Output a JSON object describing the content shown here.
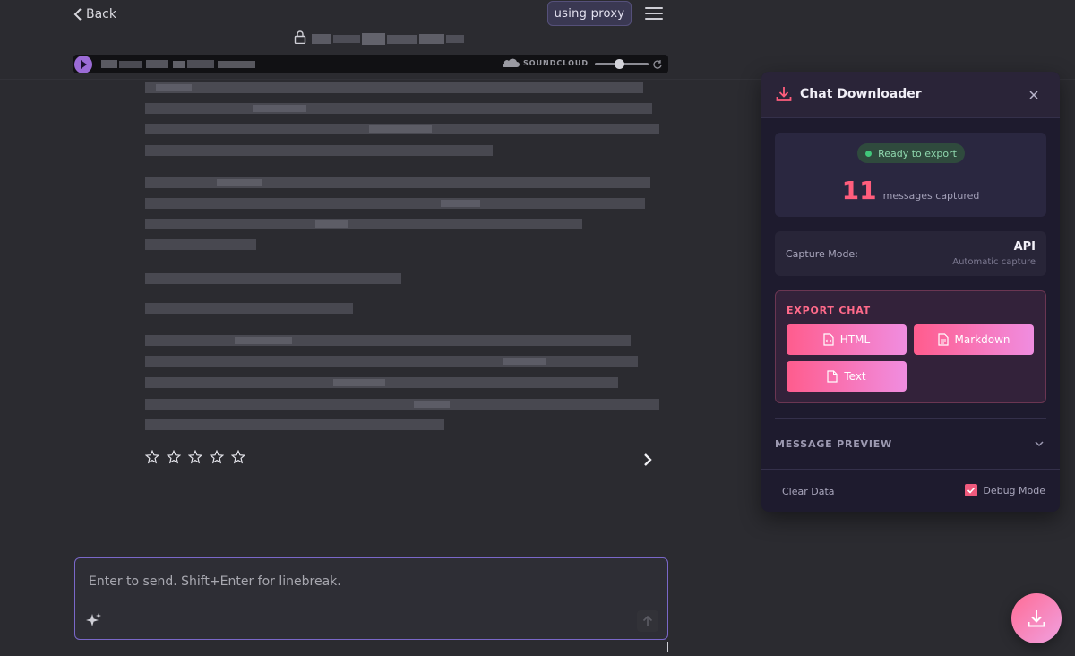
{
  "topbar": {
    "back_label": "Back",
    "proxy_label": "using proxy"
  },
  "player": {
    "brand": "SOUNDCLOUD",
    "volume": 0.6
  },
  "rating": {
    "stars_total": 5,
    "stars_filled": 0
  },
  "composer": {
    "placeholder": "Enter to send. Shift+Enter for linebreak."
  },
  "panel": {
    "title": "Chat Downloader",
    "status": "Ready to export",
    "message_count": "11",
    "message_count_label": "messages captured",
    "capture_mode_label": "Capture Mode:",
    "capture_mode_value": "API",
    "capture_mode_sub": "Automatic capture",
    "export_title": "EXPORT CHAT",
    "export_buttons": {
      "html": "HTML",
      "markdown": "Markdown",
      "text": "Text"
    },
    "preview_label": "MESSAGE PREVIEW",
    "clear_label": "Clear Data",
    "debug_label": "Debug Mode",
    "debug_checked": true
  },
  "colors": {
    "accent_pink": "#ff5d7c",
    "status_green": "#41c77a",
    "composer_border": "#7a68c9",
    "play_purple": "#9b6bd6"
  }
}
